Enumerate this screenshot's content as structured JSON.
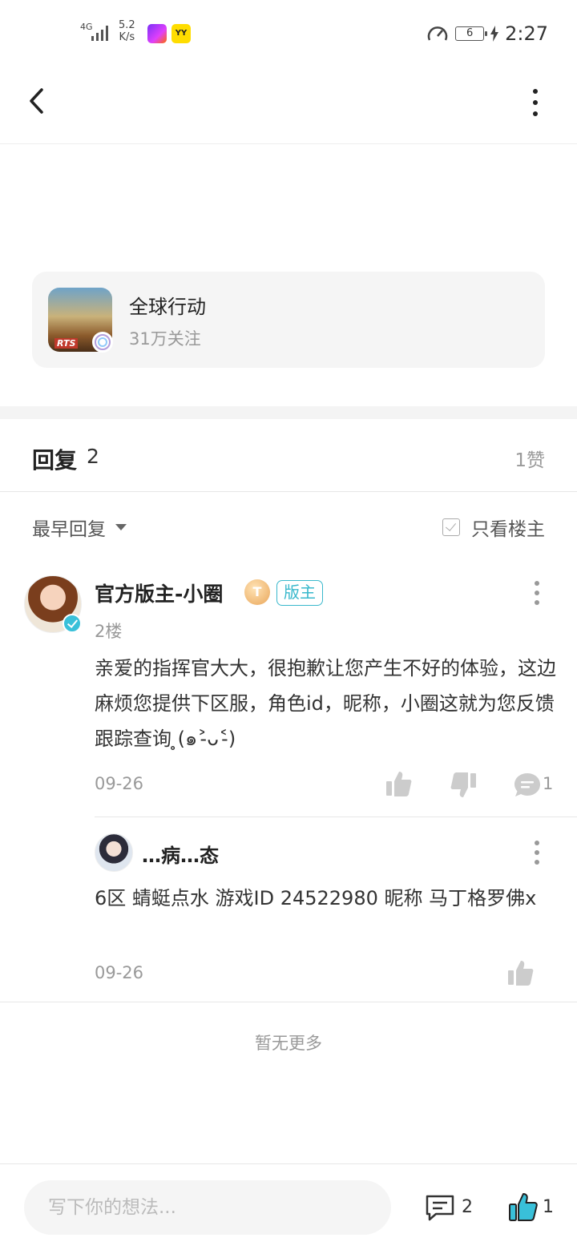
{
  "status_bar": {
    "network": "4G",
    "speed_value": "5.2",
    "speed_unit": "K/s",
    "app2_label": "YY",
    "battery": "6",
    "time": "2:27"
  },
  "game": {
    "name": "全球行动",
    "followers": "31万关注",
    "icon_tag": "RTS"
  },
  "replies_header": {
    "title": "回复",
    "count": "2",
    "likes": "1赞"
  },
  "filter": {
    "sort_label": "最早回复",
    "only_owner_label": "只看楼主"
  },
  "reply": {
    "author": "官方版主-小圈",
    "level_badge": "T",
    "role_tag": "版主",
    "floor": "2楼",
    "content": "亲爱的指挥官大大，很抱歉让您产生不好的体验，这边麻烦您提供下区服，角色id，昵称，小圈这就为您反馈跟踪查询 ̥(๑˃̵ᴗ˂̵)",
    "date": "09-26",
    "comment_count": "1"
  },
  "sub_reply": {
    "author": "…病…态",
    "content": "6区 蜻蜓点水 游戏ID 24522980 昵称 马丁格罗佛x",
    "date": "09-26"
  },
  "no_more": "暂无更多",
  "bottom_bar": {
    "placeholder": "写下你的想法...",
    "comment_count": "2",
    "like_count": "1",
    "accent_color": "#39c0d9"
  }
}
